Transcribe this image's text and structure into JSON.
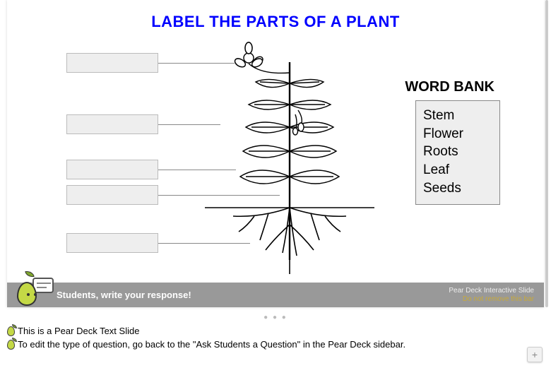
{
  "title": "LABEL THE PARTS OF A PLANT",
  "label_boxes": [
    {
      "value": ""
    },
    {
      "value": ""
    },
    {
      "value": ""
    },
    {
      "value": ""
    },
    {
      "value": ""
    }
  ],
  "wordbank": {
    "title": "WORD BANK",
    "items": [
      "Stem",
      "Flower",
      "Roots",
      "Leaf",
      "Seeds"
    ]
  },
  "footer": {
    "prompt": "Students, write your response!",
    "brand": "Pear Deck Interactive Slide",
    "warning": "Do not remove this bar"
  },
  "notes": {
    "line1": "This is a Pear Deck Text Slide",
    "line2": "To edit the type of question, go back to the \"Ask Students a Question\" in the Pear Deck sidebar."
  },
  "icons": {
    "pear": "pear-icon",
    "plus": "+"
  }
}
